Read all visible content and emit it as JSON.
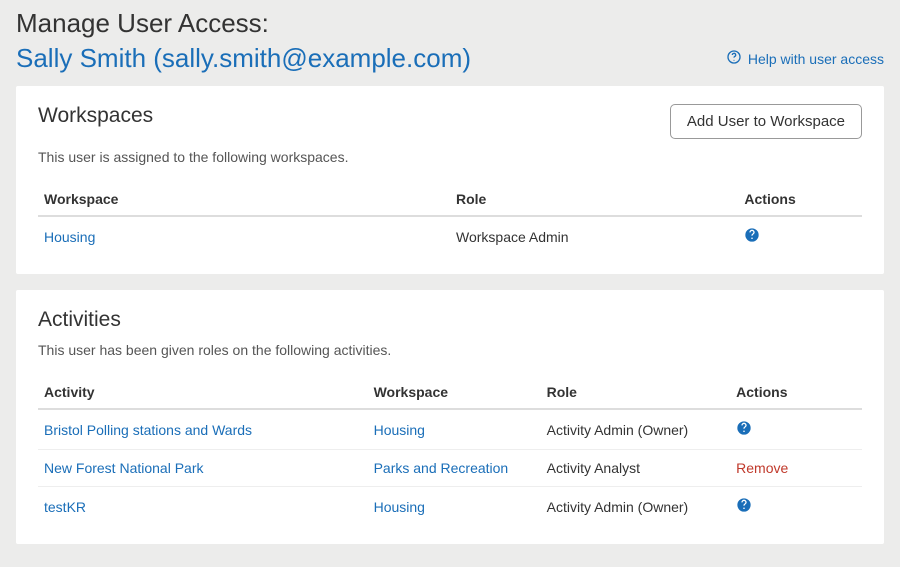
{
  "header": {
    "title": "Manage User Access:",
    "user_display": "Sally Smith (sally.smith@example.com)",
    "help_label": "Help with user access"
  },
  "workspaces_card": {
    "title": "Workspaces",
    "add_button": "Add User to Workspace",
    "description": "This user is assigned to the following workspaces.",
    "columns": {
      "workspace": "Workspace",
      "role": "Role",
      "actions": "Actions"
    },
    "rows": [
      {
        "workspace": "Housing",
        "role": "Workspace Admin",
        "action_type": "help"
      }
    ]
  },
  "activities_card": {
    "title": "Activities",
    "description": "This user has been given roles on the following activities.",
    "columns": {
      "activity": "Activity",
      "workspace": "Workspace",
      "role": "Role",
      "actions": "Actions"
    },
    "rows": [
      {
        "activity": "Bristol Polling stations and Wards",
        "workspace": "Housing",
        "role": "Activity Admin (Owner)",
        "action_type": "help"
      },
      {
        "activity": "New Forest National Park",
        "workspace": "Parks and Recreation",
        "role": "Activity Analyst",
        "action_type": "remove",
        "action_label": "Remove"
      },
      {
        "activity": "testKR",
        "workspace": "Housing",
        "role": "Activity Admin (Owner)",
        "action_type": "help"
      }
    ]
  }
}
